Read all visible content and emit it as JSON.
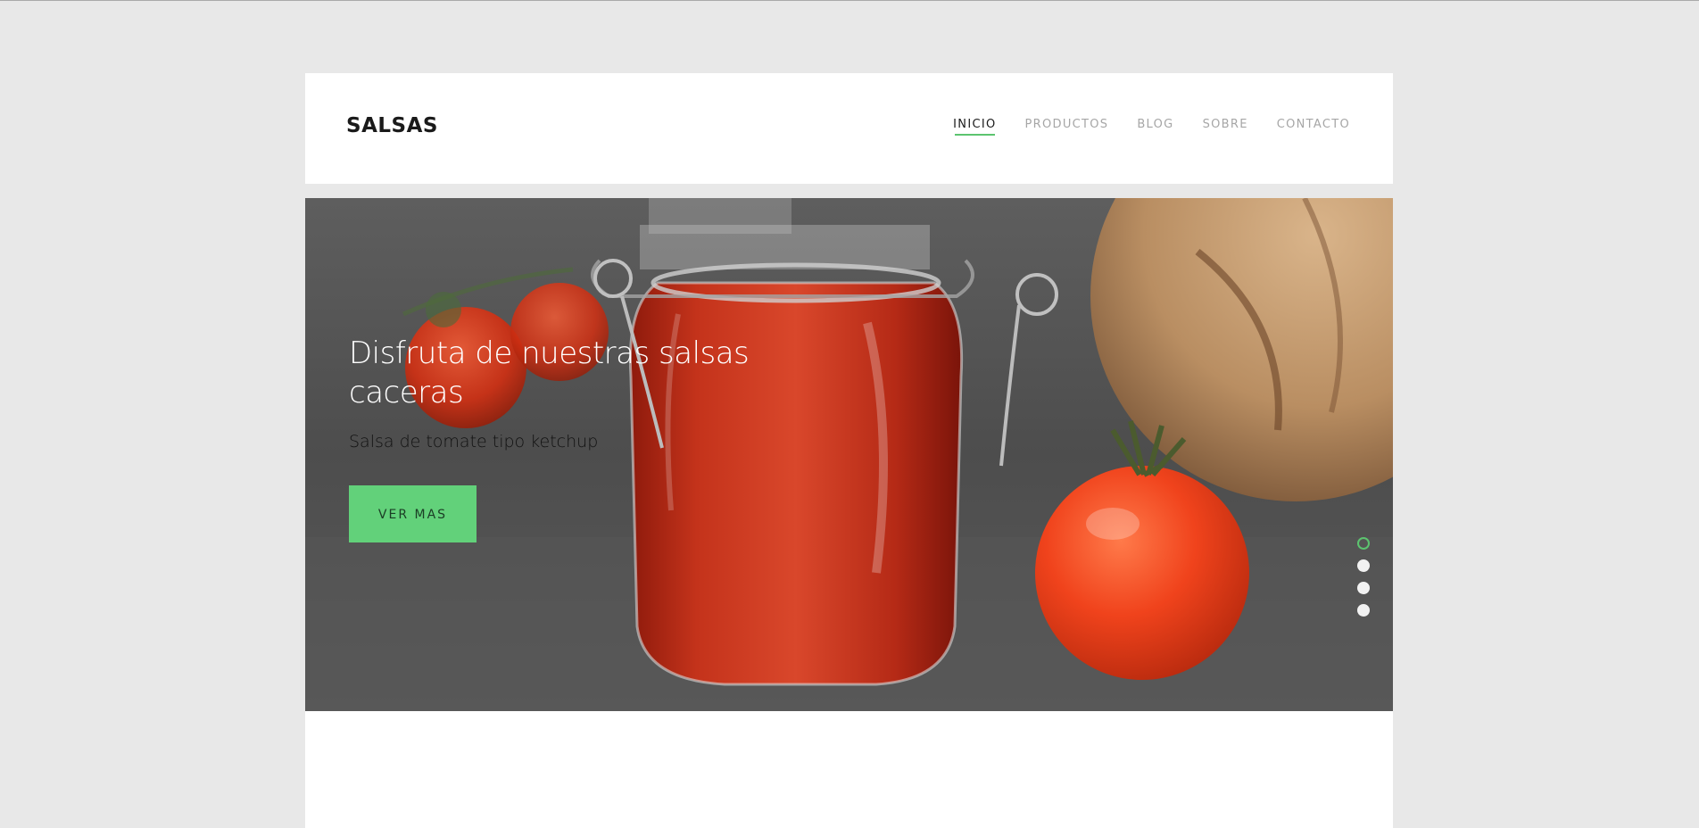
{
  "brand": {
    "name": "SALSAS"
  },
  "nav": {
    "items": [
      {
        "label": "INICIO",
        "active": true
      },
      {
        "label": "PRODUCTOS",
        "active": false
      },
      {
        "label": "BLOG",
        "active": false
      },
      {
        "label": "SOBRE",
        "active": false
      },
      {
        "label": "CONTACTO",
        "active": false
      }
    ]
  },
  "hero": {
    "title": "Disfruta de nuestras salsas caceras",
    "subtitle": "Salsa de tomate tipo ketchup",
    "button_label": "VER MAS",
    "image": "jar-of-tomato-sauce-with-tomatoes",
    "slides": 4,
    "active_slide": 1
  },
  "colors": {
    "accent": "#5cc46f",
    "button": "#62d17a",
    "page_bg": "#e8e8e8"
  }
}
